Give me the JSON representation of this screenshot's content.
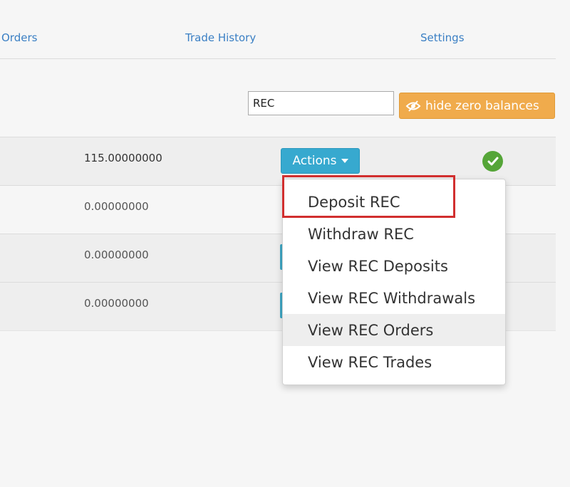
{
  "nav": {
    "orders": "Orders",
    "trade_history": "Trade History",
    "settings": "Settings"
  },
  "filter": {
    "value": "REC",
    "hide_zero_label": "hide zero balances"
  },
  "balances": [
    {
      "amount": "115.00000000"
    },
    {
      "amount": "0.00000000"
    },
    {
      "amount": "0.00000000"
    },
    {
      "amount": "0.00000000"
    }
  ],
  "actions": {
    "label": "Actions",
    "menu": [
      {
        "label": "Deposit REC"
      },
      {
        "label": "Withdraw REC"
      },
      {
        "label": "View REC Deposits"
      },
      {
        "label": "View REC Withdrawals"
      },
      {
        "label": "View REC Orders"
      },
      {
        "label": "View REC Trades"
      }
    ]
  },
  "colors": {
    "link": "#3a7fc4",
    "actions_button": "#37a9cf",
    "hide_button": "#f0ab4c",
    "check": "#55a538",
    "highlight": "#d12f2f"
  },
  "icons": {
    "hide_button": "eye-slash-icon",
    "status": "check-circle-icon",
    "dropdown": "caret-down-icon"
  }
}
